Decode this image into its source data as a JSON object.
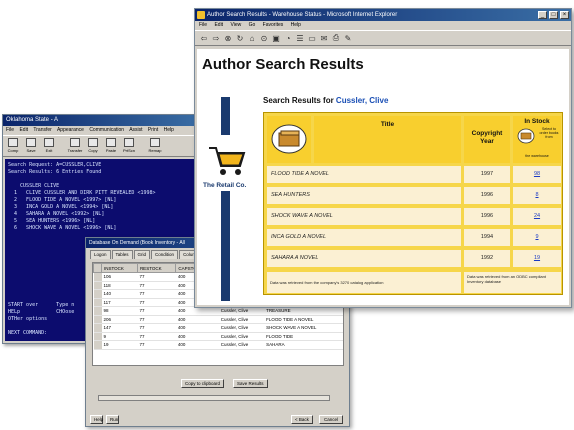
{
  "terminal": {
    "title": "Oklahoma State - A",
    "menu": [
      "File",
      "Edit",
      "Transfer",
      "Appearance",
      "Communication",
      "Assist",
      "Print",
      "Help"
    ],
    "toolbar": [
      "Comp",
      "Save",
      "Exit",
      "Transfer",
      "Copy",
      "Paste",
      "PrtScn",
      "Remap"
    ],
    "lines": [
      "Search Request: A=CUSSLER,CLIVE",
      "Search Results: 6 Entries Found",
      "",
      "    CUSSLER CLIVE",
      "  1   CLIVE CUSSLER AND DIRK PITT REVEALED <1998>",
      "  2   FLOOD TIDE A NOVEL <1997> [NL]",
      "  3   INCA GOLD A NOVEL <1994> [NL]",
      "  4   SAHARA A NOVEL <1992> [NL]",
      "  5   SEA HUNTERS <1996> [NL]",
      "  6   SHOCK WAVE A NOVEL <1996> [NL]",
      "",
      "",
      "",
      "",
      "",
      "",
      "",
      "",
      "",
      "",
      "START over      Type n",
      "HELp            CHOose",
      "OTHer options",
      "",
      "NEXT COMMAND:"
    ]
  },
  "dialog": {
    "title": "Database On Demand (Book Inventory - All",
    "tabs": [
      "Logon",
      "Tables",
      "Grid",
      "Condition",
      "Columns",
      "Sort"
    ],
    "columns": [
      "INSTOCK",
      "RESTOCK",
      "CAPSTOCK",
      "AUTHOR",
      "TITLE"
    ],
    "rows": [
      [
        "106",
        "77",
        "400",
        "Cussler, Clive",
        ""
      ],
      [
        "118",
        "77",
        "400",
        "Cussler, Clive",
        ""
      ],
      [
        "140",
        "77",
        "400",
        "Cussler, Clive",
        ""
      ],
      [
        "117",
        "77",
        "400",
        "Cussler, Clive",
        "SAHARA A NOVEL"
      ],
      [
        "98",
        "77",
        "400",
        "Cussler, Clive",
        "TREASURE"
      ],
      [
        "206",
        "77",
        "400",
        "Cussler, Clive",
        "FLOOD TIDE A NOVEL"
      ],
      [
        "147",
        "77",
        "400",
        "Cussler, Clive",
        "SHOCK WAVE A NOVEL"
      ],
      [
        "9",
        "77",
        "400",
        "Cussler, Clive",
        "FLOOD TIDE"
      ],
      [
        "19",
        "77",
        "400",
        "Cussler, Clive",
        "SAHARA"
      ]
    ],
    "copy_btn": "Copy to clipboard",
    "save_btn": "Save Results",
    "help_btn": "Help",
    "run_btn": "Run",
    "back_btn": "< Back",
    "cancel_btn": "Cancel",
    "progress": 0.0
  },
  "browser": {
    "title": "Author Search Results - Warehouse Status - Microsoft Internet Explorer",
    "menus": [
      "File",
      "Edit",
      "View",
      "Go",
      "Favorites",
      "Help"
    ],
    "heading": "Author Search Results",
    "logo_text": "The Retail Co.",
    "search_prefix": "Search Results for ",
    "search_author": "Cussler, Clive",
    "table": {
      "col_title": "Title",
      "col_year": "Copyright Year",
      "col_stock": "In Stock",
      "stock_note": "Select to order books from",
      "stock_note2": "the warehouse",
      "rows": [
        {
          "title": "FLOOD TIDE A NOVEL",
          "year": "1997",
          "stock": "98"
        },
        {
          "title": "SEA HUNTERS",
          "year": "1996",
          "stock": "8"
        },
        {
          "title": "SHOCK WAVE A NOVEL",
          "year": "1996",
          "stock": "24"
        },
        {
          "title": "INCA GOLD A NOVEL",
          "year": "1994",
          "stock": "9"
        },
        {
          "title": "SAHARA A NOVEL",
          "year": "1992",
          "stock": "19"
        }
      ],
      "footer_left": "Data was retrieved from the company's 3270 catalog application",
      "footer_right": "Data was retrieved from an ODBC compliant Inventory database"
    }
  },
  "colors": {
    "accent": "#f6d64a",
    "navy": "#1a3a6e",
    "link": "#1a3ac4"
  }
}
